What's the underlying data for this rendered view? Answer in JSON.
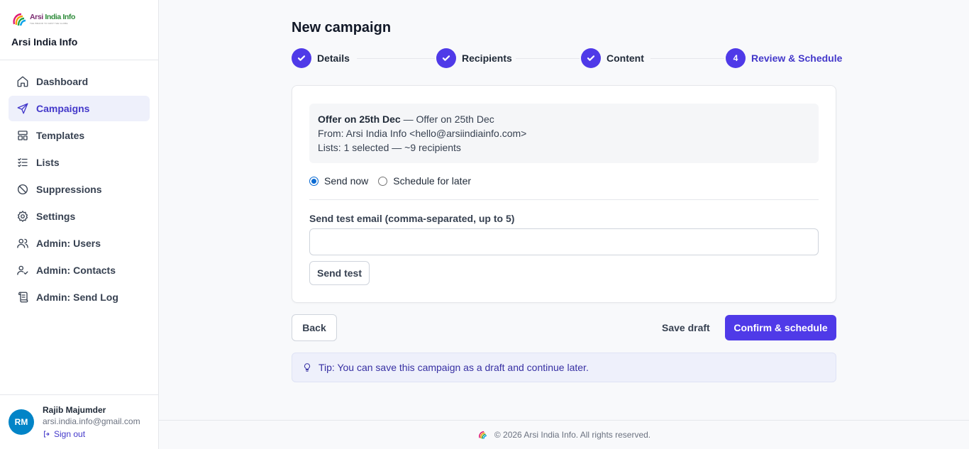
{
  "brand": {
    "logo_text_a": "Arsi ",
    "logo_text_b": "India Info",
    "logo_tagline": "THE BRAND TO GRIP THE GLOBE",
    "title": "Arsi India Info"
  },
  "sidebar": {
    "items": [
      {
        "label": "Dashboard",
        "icon": "home-icon"
      },
      {
        "label": "Campaigns",
        "icon": "send-icon",
        "active": true
      },
      {
        "label": "Templates",
        "icon": "layout-icon"
      },
      {
        "label": "Lists",
        "icon": "list-checks-icon"
      },
      {
        "label": "Suppressions",
        "icon": "ban-icon"
      },
      {
        "label": "Settings",
        "icon": "gear-icon"
      },
      {
        "label": "Admin: Users",
        "icon": "users-icon"
      },
      {
        "label": "Admin: Contacts",
        "icon": "user-check-icon"
      },
      {
        "label": "Admin: Send Log",
        "icon": "scroll-icon"
      }
    ]
  },
  "user": {
    "initials": "RM",
    "name": "Rajib Majumder",
    "email": "arsi.india.info@gmail.com",
    "signout": "Sign out"
  },
  "page": {
    "title": "New campaign"
  },
  "stepper": {
    "steps": [
      {
        "label": "Details",
        "state": "done"
      },
      {
        "label": "Recipients",
        "state": "done"
      },
      {
        "label": "Content",
        "state": "done"
      },
      {
        "label": "Review & Schedule",
        "state": "current",
        "number": "4"
      }
    ]
  },
  "summary": {
    "campaign_name": "Offer on 25th Dec",
    "subject_sep": " — ",
    "subject": "Offer on 25th Dec",
    "from_line": "From: Arsi India Info <hello@arsiindiainfo.com>",
    "lists_line": "Lists: 1 selected — ~9 recipients"
  },
  "schedule": {
    "send_now": "Send now",
    "schedule_later": "Schedule for later",
    "selected": "send_now"
  },
  "test_email": {
    "label": "Send test email (comma-separated, up to 5)",
    "value": "",
    "placeholder": "",
    "button": "Send test"
  },
  "actions": {
    "back": "Back",
    "save_draft": "Save draft",
    "confirm": "Confirm & schedule"
  },
  "tip": {
    "text": "Tip: You can save this campaign as a draft and continue later."
  },
  "footer": {
    "text": "© 2026 Arsi India Info. All rights reserved."
  },
  "colors": {
    "accent": "#4f3ae8",
    "accent_text": "#4338ca",
    "avatar": "#0284c7",
    "active_bg": "#eef0fb"
  }
}
